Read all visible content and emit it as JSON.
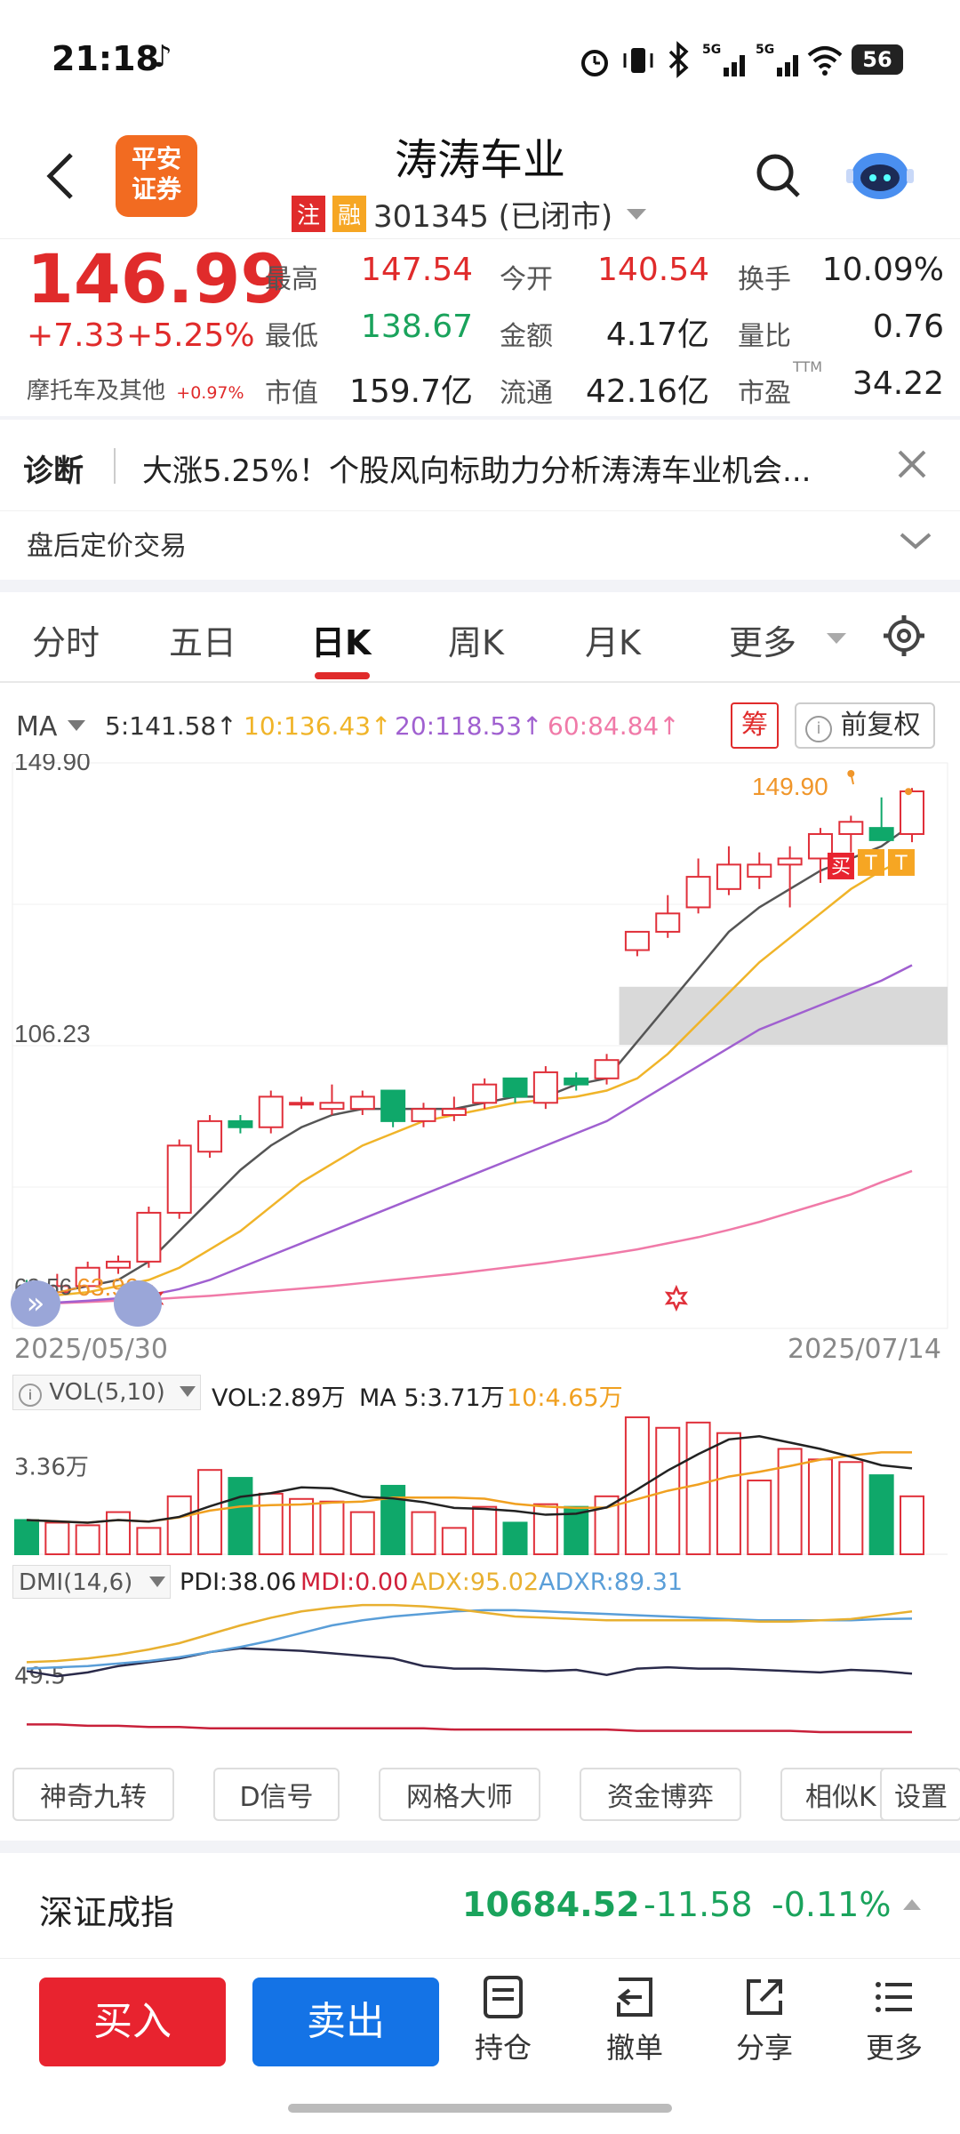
{
  "status_bar": {
    "time": "21:18",
    "battery": "56"
  },
  "header": {
    "logo_text": "平安\n证券",
    "title": "涛涛车业",
    "badge_zhu": "注",
    "badge_rong": "融",
    "code_status": "301345 (已闭市)"
  },
  "quote": {
    "price": "146.99",
    "change": "+7.33",
    "change_pct": "+5.25%",
    "sector": "摩托车及其他",
    "sector_pct": "+0.97%",
    "stats": [
      {
        "label": "最高",
        "value": "147.54",
        "color": "red"
      },
      {
        "label": "今开",
        "value": "140.54",
        "color": "red"
      },
      {
        "label": "换手",
        "value": "10.09%",
        "color": "dark"
      },
      {
        "label": "最低",
        "value": "138.67",
        "color": "green"
      },
      {
        "label": "金额",
        "value": "4.17亿",
        "color": "dark"
      },
      {
        "label": "量比",
        "value": "0.76",
        "color": "dark"
      },
      {
        "label": "市值",
        "value": "159.7亿",
        "color": "dark"
      },
      {
        "label": "流通",
        "value": "42.16亿",
        "color": "dark"
      },
      {
        "label": "市盈",
        "value": "34.22",
        "color": "dark",
        "sup": "TTM"
      }
    ]
  },
  "diagnosis": {
    "label": "诊断",
    "text": "大涨5.25%！个股风向标助力分析涛涛车业机会..."
  },
  "after_hours": {
    "label": "盘后定价交易"
  },
  "tabs": [
    "分时",
    "五日",
    "日K",
    "周K",
    "月K",
    "更多"
  ],
  "active_tab": "日K",
  "ma_legend": {
    "label": "MA",
    "items": [
      {
        "text": "5:141.58↑",
        "color": "#333333"
      },
      {
        "text": "10:136.43↑",
        "color": "#f0b429"
      },
      {
        "text": "20:118.53↑",
        "color": "#a060d0"
      },
      {
        "text": "60:84.84↑",
        "color": "#f07aa8"
      }
    ],
    "chou": "筹",
    "fq": "前复权"
  },
  "chart_data": {
    "type": "candlestick",
    "y_labels": [
      "149.90",
      "106.23",
      "62.56"
    ],
    "high_marker": "149.90",
    "low_marker": "63.90",
    "x_start": "2025/05/30",
    "x_end": "2025/07/14",
    "ylim": [
      62.56,
      149.9
    ],
    "candles": [
      [
        65,
        67,
        63.9,
        64.5
      ],
      [
        65,
        68,
        64,
        66
      ],
      [
        66,
        70,
        65.5,
        69
      ],
      [
        69,
        71,
        68,
        70
      ],
      [
        70,
        79,
        69,
        78
      ],
      [
        78,
        90,
        77,
        89
      ],
      [
        88,
        94,
        87,
        93
      ],
      [
        93,
        94,
        91,
        92
      ],
      [
        92,
        98,
        91,
        97
      ],
      [
        96,
        97,
        95,
        96
      ],
      [
        95,
        99,
        94,
        96
      ],
      [
        95,
        98,
        94,
        97
      ],
      [
        98,
        97,
        92,
        93
      ],
      [
        93,
        96,
        92,
        95
      ],
      [
        94,
        97,
        93,
        95
      ],
      [
        96,
        100,
        95,
        99
      ],
      [
        100,
        100,
        96,
        97
      ],
      [
        96,
        102,
        95,
        101
      ],
      [
        100,
        101,
        98,
        99
      ],
      [
        100,
        104,
        99,
        103
      ],
      [
        121,
        124,
        120,
        124
      ],
      [
        124,
        130,
        123,
        127
      ],
      [
        128,
        136,
        127,
        133
      ],
      [
        131,
        138,
        130,
        135
      ],
      [
        133,
        137,
        131,
        135
      ],
      [
        135,
        138,
        128,
        136
      ],
      [
        136,
        141,
        132,
        140
      ],
      [
        140,
        143,
        137,
        142
      ],
      [
        141,
        146,
        139,
        139
      ],
      [
        140,
        147.54,
        138.67,
        146.99
      ]
    ],
    "ma5": [
      64,
      65,
      66,
      67,
      70,
      75,
      80,
      85,
      89,
      92,
      94,
      95,
      95,
      95,
      95,
      96,
      97,
      97,
      99,
      100,
      106,
      112,
      118,
      124,
      128,
      131,
      134,
      136,
      138,
      141.58
    ],
    "ma10": [
      64,
      64.5,
      65,
      66,
      67,
      69,
      72,
      75,
      79,
      83,
      86,
      89,
      91,
      93,
      94,
      95,
      96,
      96.5,
      97,
      98,
      100,
      104,
      109,
      114,
      119,
      123,
      127,
      131,
      134,
      136.43
    ],
    "ma20": [
      63,
      63.3,
      63.6,
      64,
      64.5,
      65.5,
      67,
      69,
      71,
      73,
      75,
      77,
      79,
      81,
      83,
      85,
      87,
      89,
      91,
      93,
      96,
      99,
      102,
      105,
      108,
      110,
      112,
      114,
      116,
      118.53
    ],
    "ma60": [
      63,
      63.2,
      63.4,
      63.6,
      63.8,
      64.1,
      64.4,
      64.8,
      65.2,
      65.6,
      66,
      66.5,
      67,
      67.5,
      68,
      68.6,
      69.2,
      69.8,
      70.5,
      71.2,
      72,
      73,
      74,
      75.2,
      76.5,
      78,
      79.5,
      81,
      83,
      84.84
    ],
    "volume": {
      "legend": "VOL(5,10)",
      "vol_text": "VOL:2.89万",
      "ma5_text": "MA 5:3.71万",
      "ma10_text": "10:4.65万",
      "y_label": "3.36万",
      "values": [
        1.3,
        1.2,
        1.1,
        1.6,
        1.0,
        2.2,
        3.2,
        2.9,
        2.3,
        2.1,
        2.0,
        1.6,
        2.6,
        1.6,
        1.0,
        1.8,
        1.2,
        1.9,
        1.8,
        2.2,
        5.2,
        4.8,
        5.0,
        4.6,
        2.8,
        4.0,
        3.6,
        3.5,
        3.0,
        2.2
      ]
    },
    "dmi": {
      "legend": "DMI(14,6)",
      "pdi_text": "PDI:38.06",
      "mdi_text": "MDI:0.00",
      "adx_text": "ADX:95.02",
      "adxr_text": "ADXR:89.31",
      "y_label": "49.5",
      "pdi": [
        48,
        44,
        47,
        52,
        55,
        58,
        63,
        66,
        65,
        64,
        62,
        60,
        58,
        52,
        50,
        50,
        49,
        48,
        49,
        45,
        50,
        51,
        50,
        50,
        49,
        48,
        47,
        49,
        48,
        46
      ],
      "adx": [
        55,
        56,
        58,
        61,
        65,
        70,
        77,
        84,
        90,
        95,
        98,
        100,
        100,
        99,
        97,
        94,
        91,
        90,
        89,
        88,
        88,
        88,
        88,
        88,
        87,
        87,
        88,
        89,
        92,
        95
      ],
      "adxr": [
        50,
        51,
        52,
        54,
        56,
        59,
        63,
        67,
        72,
        78,
        84,
        88,
        91,
        93,
        95,
        96,
        96,
        95,
        94,
        93,
        92,
        91,
        90,
        89,
        88,
        88,
        88,
        88,
        89,
        89.31
      ],
      "mdi": [
        6,
        6,
        5,
        5,
        4,
        4,
        3,
        3,
        3,
        3,
        3,
        3,
        3,
        3,
        2,
        2,
        2,
        2,
        2,
        2,
        1,
        1,
        1,
        1,
        1,
        1,
        0,
        0,
        0,
        0
      ]
    }
  },
  "signal_labels": {
    "buy": "买",
    "t1": "T",
    "t2": "T"
  },
  "tools": [
    "神奇九转",
    "D信号",
    "网格大师",
    "资金博弈",
    "相似K",
    "设置"
  ],
  "index_bar": {
    "name": "深证成指",
    "value": "10684.52",
    "change": "-11.58",
    "pct": "-0.11%"
  },
  "bottom_nav": {
    "buy": "买入",
    "sell": "卖出",
    "items": [
      "持仓",
      "撤单",
      "分享",
      "更多"
    ]
  }
}
